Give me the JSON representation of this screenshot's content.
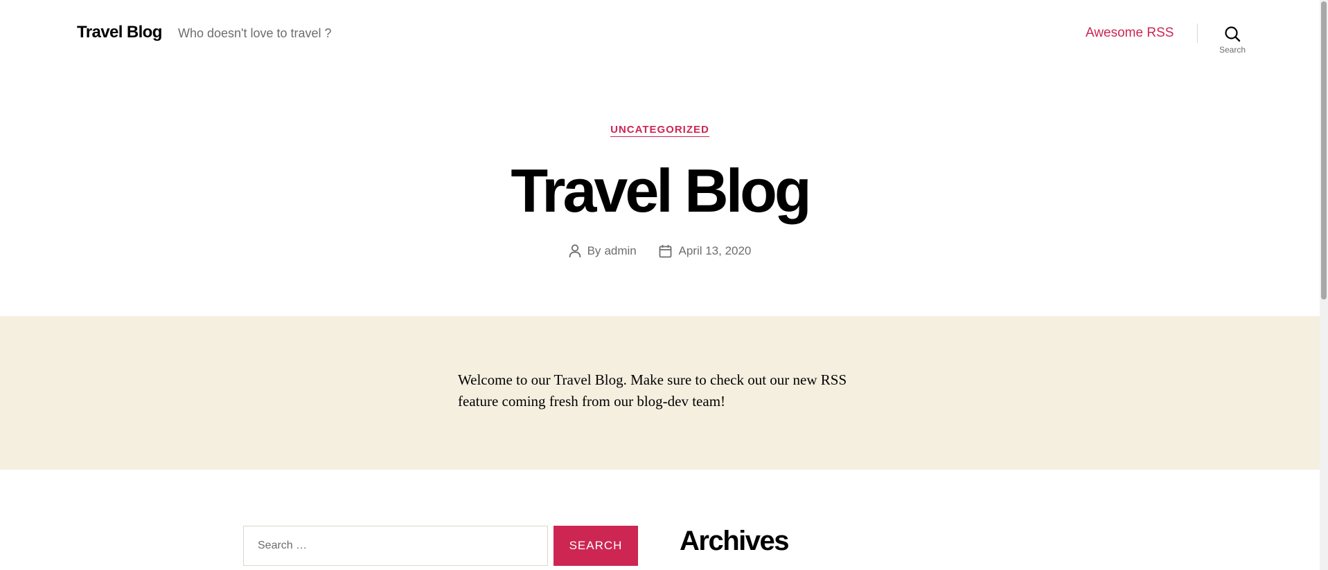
{
  "header": {
    "site_title": "Travel Blog",
    "site_description": "Who doesn't love to travel ?",
    "nav_link": "Awesome RSS",
    "search_toggle_label": "Search"
  },
  "post": {
    "category": "UNCATEGORIZED",
    "title": "Travel Blog",
    "author_prefix": "By",
    "author": "admin",
    "date": "April 13, 2020",
    "content": "Welcome to our Travel Blog. Make sure to check out our new RSS feature coming fresh from our blog-dev team!"
  },
  "widgets": {
    "search_placeholder": "Search …",
    "search_button": "SEARCH",
    "archives_title": "Archives"
  },
  "colors": {
    "accent": "#cd2653",
    "content_background": "#f5efe0",
    "text_muted": "#6d6d6d"
  },
  "icons": {
    "search_toggle": "search-icon",
    "author": "user-icon",
    "date": "calendar-icon"
  }
}
